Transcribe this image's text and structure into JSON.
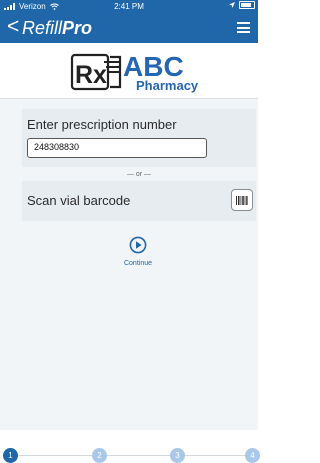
{
  "status_bar": {
    "carrier": "Verizon",
    "time": "2:41 PM"
  },
  "header": {
    "back_glyph": "<",
    "title_main": "Refill",
    "title_brand": "Pro"
  },
  "logo": {
    "mark": "Rx",
    "name_line1": "ABC",
    "name_line2": "Pharmacy"
  },
  "prescription": {
    "label": "Enter prescription number",
    "value": "248308830"
  },
  "separator": "— or —",
  "scan": {
    "label": "Scan vial barcode"
  },
  "continue": {
    "label": "Continue"
  },
  "steps": [
    "1",
    "2",
    "3",
    "4"
  ],
  "active_step": 1,
  "colors": {
    "brand_blue": "#1f67a9",
    "step_inactive": "#a9c7e8",
    "panel_bg": "#e7ecf1"
  }
}
